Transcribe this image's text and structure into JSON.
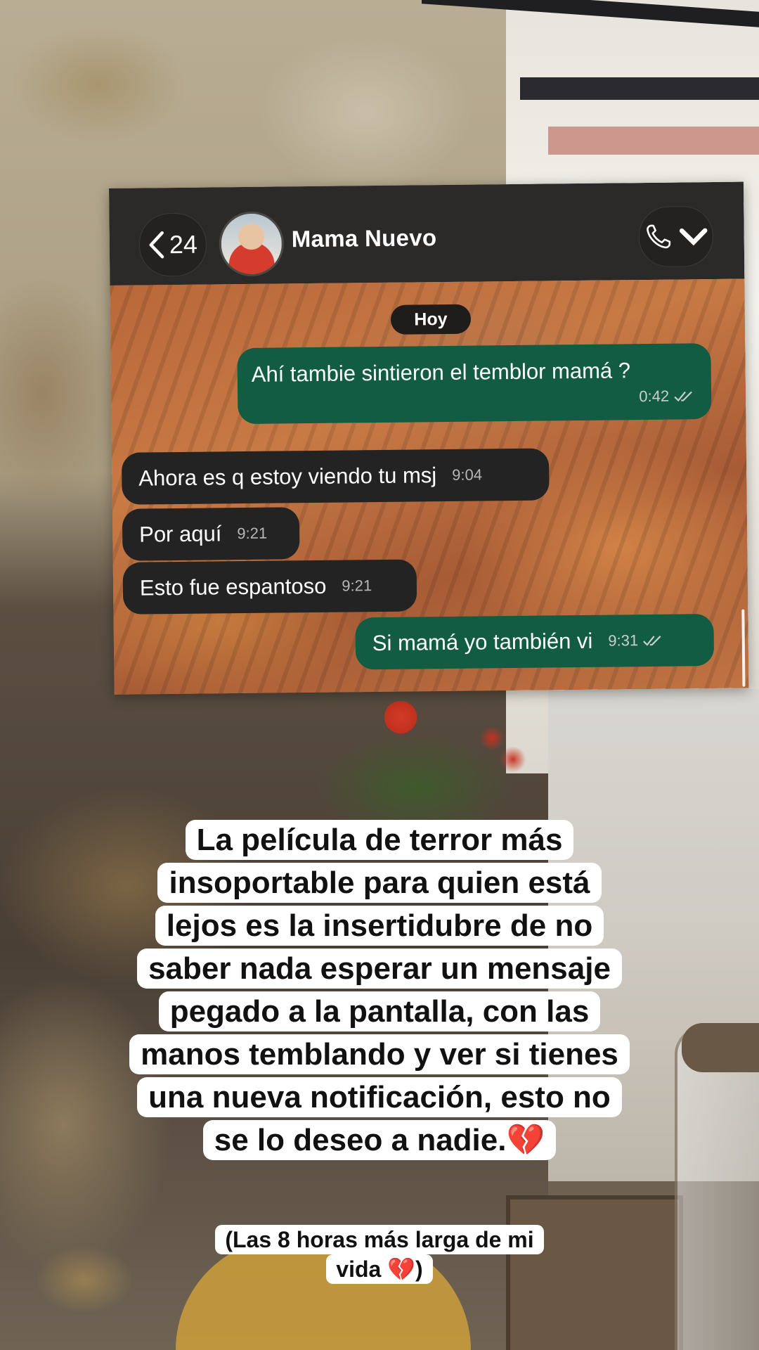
{
  "chat": {
    "back_count": "24",
    "contact_name": "Mama Nuevo",
    "date_label": "Hoy",
    "messages": [
      {
        "direction": "out",
        "text": "Ahí tambie sintieron el temblor mamá ?",
        "time": "0:42",
        "status": "read"
      },
      {
        "direction": "in",
        "text": "Ahora es q estoy viendo tu msj",
        "time": "9:04"
      },
      {
        "direction": "in",
        "text": "Por aquí",
        "time": "9:21"
      },
      {
        "direction": "in",
        "text": "Esto fue espantoso",
        "time": "9:21"
      },
      {
        "direction": "out",
        "text": "Si mamá yo también vi",
        "time": "9:31",
        "status": "read"
      }
    ],
    "colors": {
      "outgoing_bubble": "#115c43",
      "incoming_bubble": "#242323",
      "header": "#2c2a29"
    }
  },
  "captions": {
    "main": "La película de terror más insoportable para quien está lejos es la insertidubre de no saber nada esperar un mensaje pegado a la pantalla, con las manos temblando y ver si tienes una nueva notificación, esto no se lo deseo a nadie.💔",
    "sub": "(Las 8 horas más larga de mi vida 💔)"
  },
  "icons": [
    "chevron-left-icon",
    "phone-icon",
    "chevron-down-icon",
    "double-check-icon",
    "broken-heart-emoji"
  ]
}
